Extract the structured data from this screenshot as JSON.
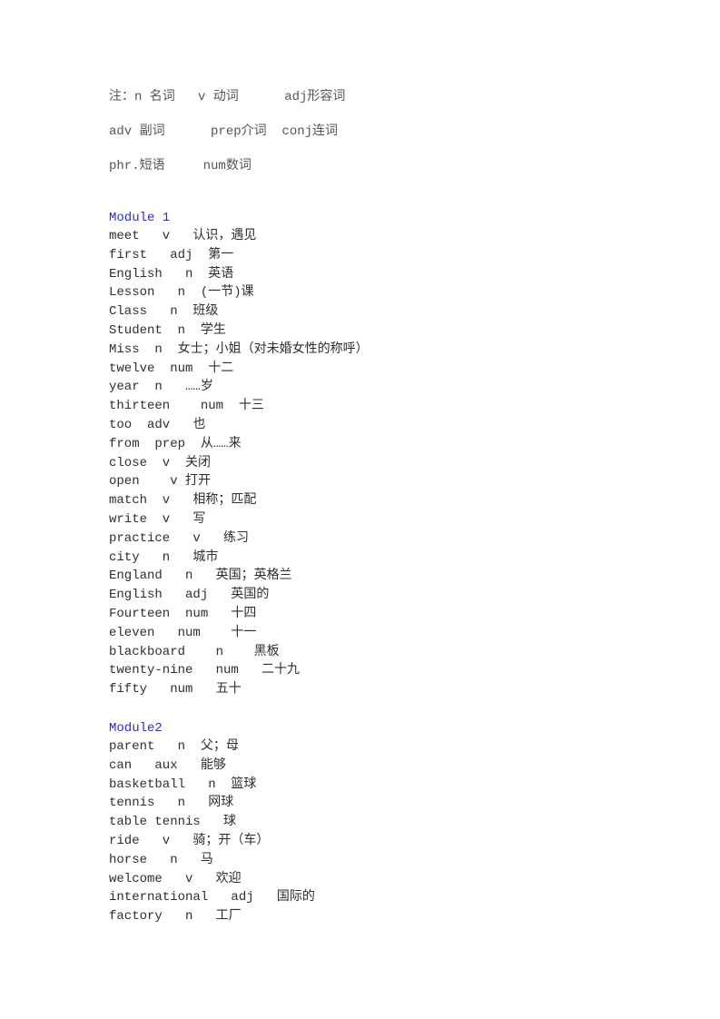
{
  "legend": [
    "注：n 名词   v 动词      adj形容词",
    "adv 副词      prep介词  conj连词",
    "phr.短语     num数词"
  ],
  "modules": [
    {
      "title": "Module 1",
      "entries": [
        "meet   v   认识，遇见",
        "first   adj  第一",
        "English   n  英语",
        "Lesson   n  (一节)课",
        "Class   n  班级",
        "Student  n  学生",
        "Miss  n  女士；小姐（对未婚女性的称呼）",
        "twelve  num  十二",
        "year  n   ……岁",
        "thirteen    num  十三",
        "too  adv   也",
        "from  prep  从……来",
        "close  v  关闭",
        "open    v 打开",
        "match  v   相称；匹配",
        "write  v   写",
        "practice   v   练习",
        "city   n   城市",
        "England   n   英国；英格兰",
        "English   adj   英国的",
        "Fourteen  num   十四",
        "eleven   num    十一",
        "blackboard    n    黑板",
        "twenty-nine   num   二十九",
        "fifty   num   五十"
      ]
    },
    {
      "title": "Module2",
      "entries": [
        "parent   n  父；母",
        "can   aux   能够",
        "basketball   n  篮球",
        "tennis   n   网球",
        "table tennis   球",
        "ride   v   骑；开（车）",
        "horse   n   马",
        "welcome   v   欢迎",
        "international   adj   国际的",
        "factory   n   工厂"
      ]
    }
  ]
}
